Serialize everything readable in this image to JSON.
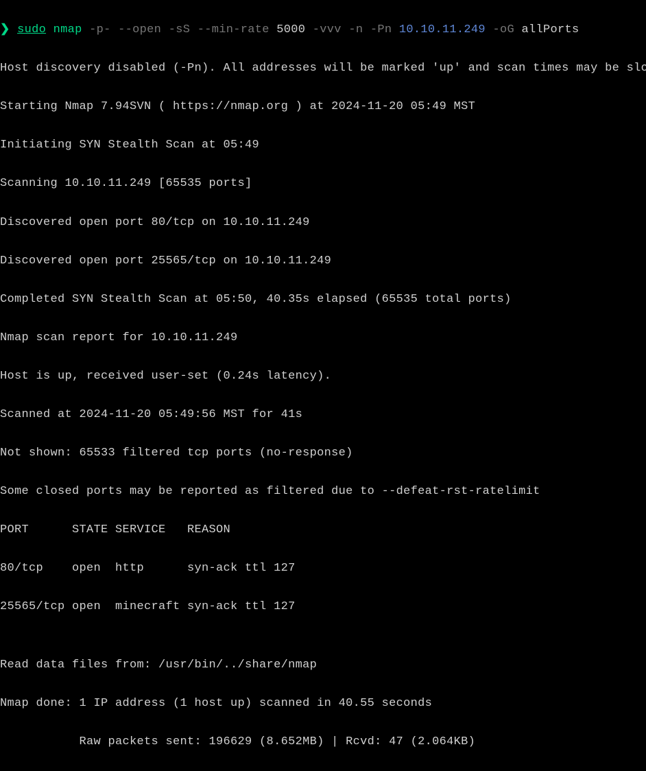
{
  "prompt": {
    "arrow": "❯",
    "sudo": "sudo",
    "cmd": "nmap",
    "flag1": "-p-",
    "flag2": "--open",
    "flag3": "-sS",
    "flag4": "--min-rate",
    "rate": "5000",
    "flag5": "-vvv",
    "flag6": "-n",
    "flag7": "-Pn",
    "target": "10.10.11.249",
    "flag8": "-oG",
    "outfile": "allPorts"
  },
  "output": {
    "l1": "Host discovery disabled (-Pn). All addresses will be marked 'up' and scan times may be slower.",
    "l2": "Starting Nmap 7.94SVN ( https://nmap.org ) at 2024-11-20 05:49 MST",
    "l3": "Initiating SYN Stealth Scan at 05:49",
    "l4": "Scanning 10.10.11.249 [65535 ports]",
    "l5": "Discovered open port 80/tcp on 10.10.11.249",
    "l6": "Discovered open port 25565/tcp on 10.10.11.249",
    "l7": "Completed SYN Stealth Scan at 05:50, 40.35s elapsed (65535 total ports)",
    "l8": "Nmap scan report for 10.10.11.249",
    "l9": "Host is up, received user-set (0.24s latency).",
    "l10": "Scanned at 2024-11-20 05:49:56 MST for 41s",
    "l11": "Not shown: 65533 filtered tcp ports (no-response)",
    "l12": "Some closed ports may be reported as filtered due to --defeat-rst-ratelimit",
    "l13": "PORT      STATE SERVICE   REASON",
    "l14": "80/tcp    open  http      syn-ack ttl 127",
    "l15": "25565/tcp open  minecraft syn-ack ttl 127",
    "l16": "",
    "l17": "Read data files from: /usr/bin/../share/nmap",
    "l18": "Nmap done: 1 IP address (1 host up) scanned in 40.55 seconds",
    "l19": "           Raw packets sent: 196629 (8.652MB) | Rcvd: 47 (2.064KB)"
  }
}
